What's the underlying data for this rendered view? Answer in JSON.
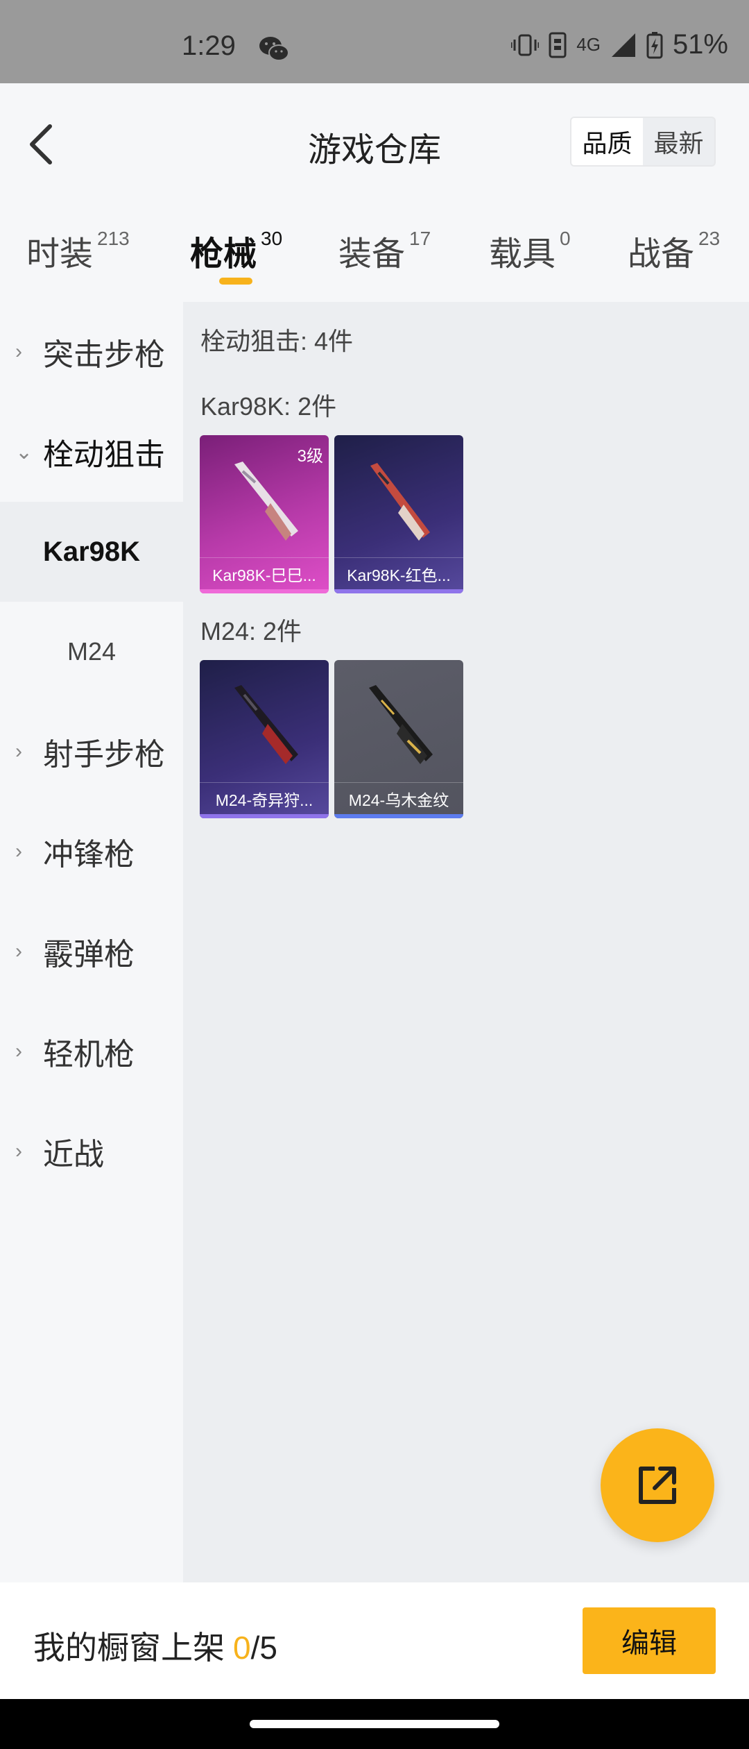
{
  "status_bar": {
    "time": "1:29",
    "network": "4G",
    "battery": "51%",
    "icons": [
      "wechat-icon",
      "vibrate-icon",
      "sim-icon",
      "signal-icon",
      "battery-charging-icon"
    ]
  },
  "header": {
    "title": "游戏仓库",
    "sort_options": [
      "品质",
      "最新"
    ],
    "sort_selected": "品质",
    "back_icon": "back-arrow-icon"
  },
  "tabs": [
    {
      "label": "时装",
      "count": "213"
    },
    {
      "label": "枪械",
      "count": "30"
    },
    {
      "label": "装备",
      "count": "17"
    },
    {
      "label": "载具",
      "count": "0"
    },
    {
      "label": "战备",
      "count": "23"
    }
  ],
  "active_tab": "枪械",
  "sidebar": {
    "items": [
      {
        "label": "突击步枪"
      },
      {
        "label": "栓动狙击",
        "subitems": [
          "Kar98K",
          "M24"
        ]
      },
      {
        "label": "射手步枪"
      },
      {
        "label": "冲锋枪"
      },
      {
        "label": "霰弹枪"
      },
      {
        "label": "轻机枪"
      },
      {
        "label": "近战"
      }
    ],
    "selected_sub": "Kar98K"
  },
  "content": {
    "category_summary": "栓动狙击: 4件",
    "groups": [
      {
        "heading": "Kar98K: 2件",
        "items": [
          {
            "name": "Kar98K-巳巳...",
            "level": "3级",
            "quality": "pink"
          },
          {
            "name": "Kar98K-红色...",
            "quality": "purple"
          }
        ]
      },
      {
        "heading": "M24: 2件",
        "items": [
          {
            "name": "M24-奇异狩...",
            "quality": "purple"
          },
          {
            "name": "M24-乌木金纹",
            "quality": "gray"
          }
        ]
      }
    ]
  },
  "fab": {
    "icon": "share-external-icon"
  },
  "bottom_bar": {
    "showcase_label": "我的橱窗上架",
    "showcase_current": "0",
    "showcase_total": "/5",
    "edit_label": "编辑"
  },
  "colors": {
    "accent": "#fbb41a",
    "pink_quality": "#df4fc8",
    "purple_quality": "#574a9e",
    "gray_quality": "#5c5d68"
  }
}
